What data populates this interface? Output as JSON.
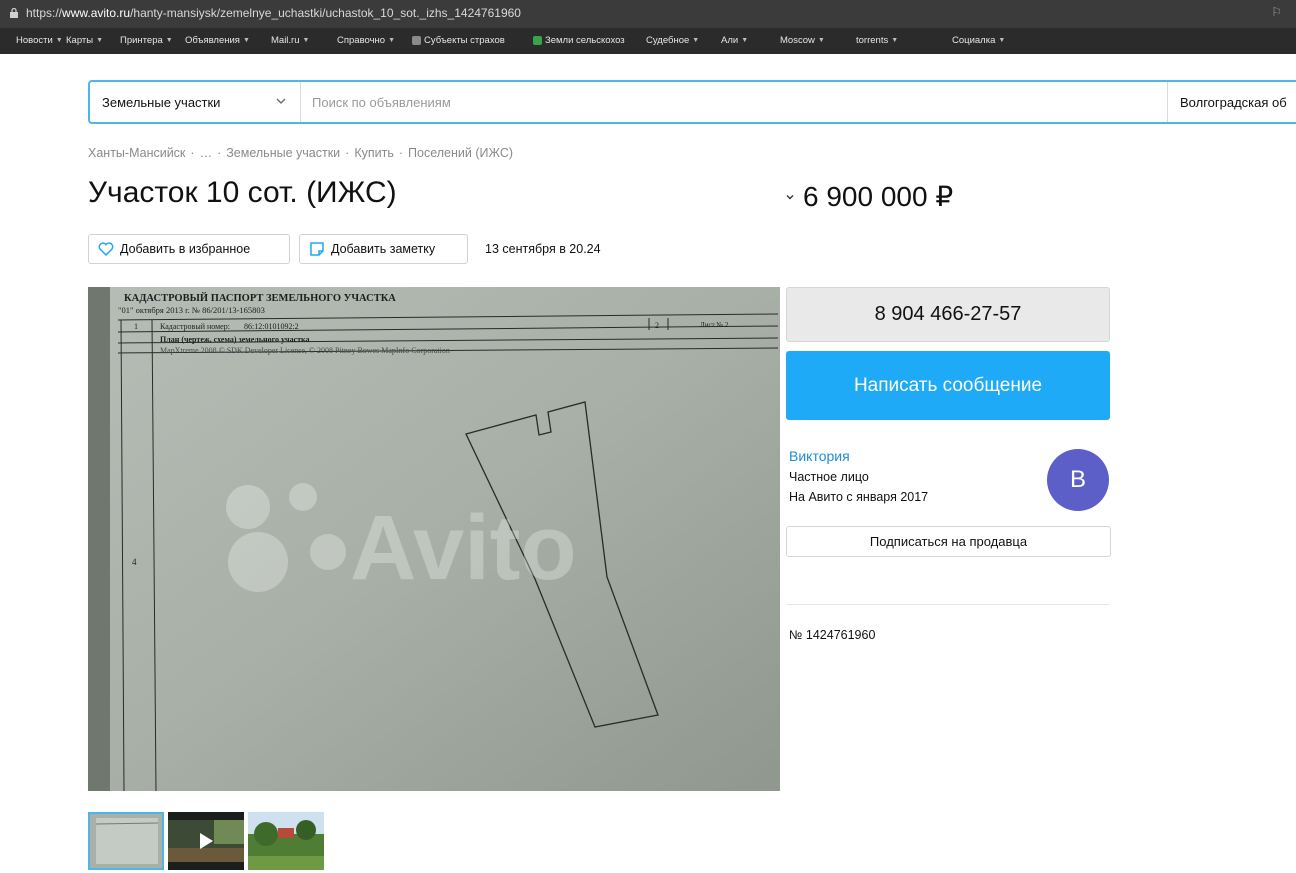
{
  "browser": {
    "url_prefix": "https://",
    "url_host": "www.avito.ru",
    "url_path": "/hanty-mansiysk/zemelnye_uchastki/uchastok_10_sot._izhs_1424761960",
    "right_icon": "translate-icon"
  },
  "bookmarks": [
    {
      "label": "Новости",
      "arrow": "▼",
      "icon_color": ""
    },
    {
      "label": "Карты",
      "arrow": "▼",
      "icon_color": ""
    },
    {
      "label": "Принтера",
      "arrow": "▼",
      "icon_color": ""
    },
    {
      "label": "Объявления",
      "arrow": "▼",
      "icon_color": ""
    },
    {
      "label": "Mail.ru",
      "arrow": "▼",
      "icon_color": ""
    },
    {
      "label": "Справочно",
      "arrow": "▼",
      "icon_color": ""
    },
    {
      "label": "Субъекты страхов",
      "arrow": "",
      "icon_color": "#8a8a8a"
    },
    {
      "label": "Земли сельскохоз",
      "arrow": "",
      "icon_color": "#3aa34a"
    },
    {
      "label": "Судебное",
      "arrow": "▼",
      "icon_color": ""
    },
    {
      "label": "Али",
      "arrow": "▼",
      "icon_color": ""
    },
    {
      "label": "Moscow",
      "arrow": "▼",
      "icon_color": ""
    },
    {
      "label": "torrents",
      "arrow": "▼",
      "icon_color": ""
    },
    {
      "label": "Социалка",
      "arrow": "▼",
      "icon_color": ""
    }
  ],
  "search": {
    "category": "Земельные участки",
    "placeholder": "Поиск по объявлениям",
    "region": "Волгоградская об"
  },
  "breadcrumbs": [
    "Ханты-Мансийск",
    "…",
    "Земельные участки",
    "Купить",
    "Поселений (ИЖС)"
  ],
  "breadcrumb_separator": "·",
  "listing": {
    "title": "Участок 10 сот. (ИЖС)",
    "price": "6 900 000 ₽",
    "fav_label": "Добавить в избранное",
    "note_label": "Добавить заметку",
    "date": "13 сентября в 20.24",
    "ad_number": "№ 1424761960"
  },
  "image": {
    "header_line1": "КАДАСТРОВЫЙ ПАСПОРТ ЗЕМЕЛЬНОГО УЧАСТКА",
    "header_line2": "\"01\" октября 2013 г.  № 86/201/13-165803",
    "cadastral_label": "Кадастровый номер:",
    "cadastral_value": "86:12:0101092:2",
    "sheet_no": "2",
    "sheet_label": "Лист № 2",
    "plan_label": "План (чертеж, схема) земельного участка",
    "software_line": "MapXtreme 2008 © SDK Developer License, © 2008 Pitney Bowes MapInfo Corporation",
    "row_num1": "1",
    "row_num4": "4",
    "watermark": "Avito",
    "colors": {
      "paper": "#a3aba3",
      "lines": "#2a2a2a"
    }
  },
  "thumbnails": [
    {
      "name": "thumb-document",
      "active": true
    },
    {
      "name": "thumb-video",
      "active": false
    },
    {
      "name": "thumb-landscape",
      "active": false
    }
  ],
  "contact": {
    "phone": "8 904 466-27-57",
    "message_button": "Написать сообщение"
  },
  "seller": {
    "name": "Виктория",
    "type": "Частное лицо",
    "since": "На Авито с января 2017",
    "avatar_letter": "В",
    "subscribe": "Подписаться на продавца"
  },
  "colors": {
    "accent": "#1eaaf6",
    "search_border": "#4db6e8",
    "link": "#1c8cd6",
    "avatar": "#5b5fc7",
    "browser_bar": "#3b3b3b",
    "bookmarks_bar": "#2b2b2b"
  }
}
